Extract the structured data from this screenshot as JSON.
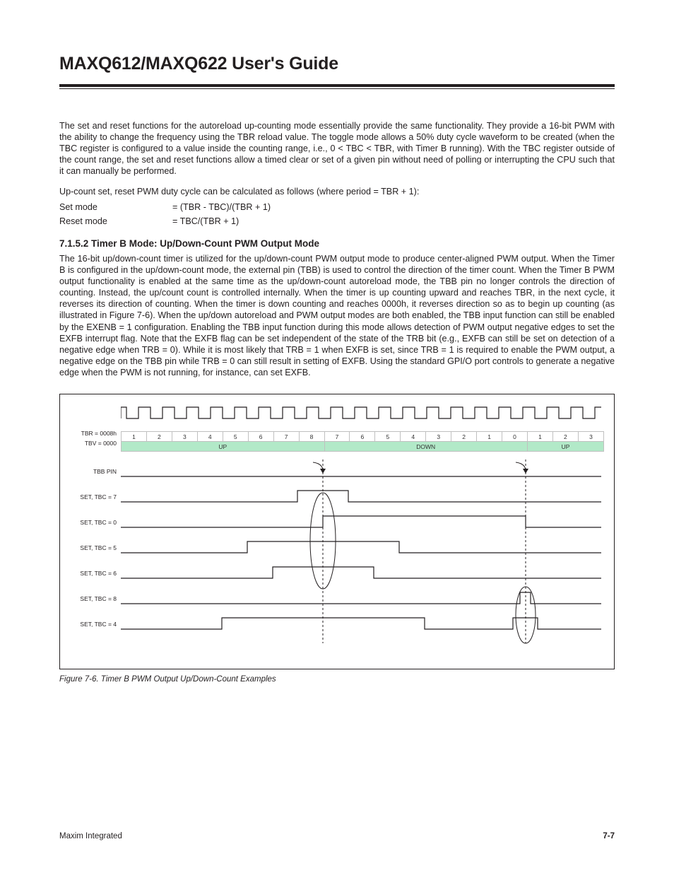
{
  "title": "MAXQ612/MAXQ622 User's Guide",
  "para1": "The set and reset functions for the autoreload up-counting mode essentially provide the same functionality. They provide a 16-bit PWM with the ability to change the frequency using the TBR reload value. The toggle mode allows a 50% duty cycle waveform to be created (when the TBC register is configured to a value inside the counting range, i.e., 0 < TBC < TBR, with Timer B running). With the TBC register outside of the count range, the set and reset functions allow a timed clear or set of a given pin without need of polling or interrupting the CPU such that it can manually be performed.",
  "para2": "Up-count set, reset PWM duty cycle can be calculated as follows (where period = TBR + 1):",
  "modes": {
    "set_label": "Set mode",
    "set_formula": "= (TBR - TBC)/(TBR + 1)",
    "reset_label": "Reset mode",
    "reset_formula": "= TBC/(TBR + 1)"
  },
  "section_heading": "7.1.5.2 Timer B Mode: Up/Down-Count PWM Output Mode",
  "para3": "The 16-bit up/down-count timer is utilized for the up/down-count PWM output mode to produce center-aligned PWM output. When the Timer B is configured in the up/down-count mode, the external pin (TBB) is used to control the direction of the timer count. When the Timer B PWM output functionality is enabled at the same time as the up/down-count autoreload mode, the TBB pin no longer controls the direction of counting. Instead, the up/count count is controlled internally. When the timer is up counting upward and reaches TBR, in the next cycle, it reverses its direction of counting. When the timer is down counting and reaches 0000h, it reverses direction so as to begin up counting (as illustrated in Figure 7-6). When the up/down autoreload and PWM output modes are both enabled, the TBB input function can still be enabled by the EXENB = 1 configuration. Enabling the TBB input function during this mode allows detection of PWM output negative edges to set the EXFB interrupt flag. Note that the EXFB flag can be set independent of the state of the TRB bit (e.g., EXFB can still be set on detection of a negative edge when TRB = 0). While it is most likely that TRB = 1 when EXFB is set, since TRB = 1 is required to enable the PWM output, a negative edge on the TBB pin while TRB = 0 can still result in setting of EXFB. Using the standard GPI/O port controls to generate a negative edge when the PWM is not running, for instance, can set EXFB.",
  "figure": {
    "tbr_label": "TBR = 0008h",
    "tbv_label": "TBV = 0000",
    "counts": [
      "1",
      "2",
      "3",
      "4",
      "5",
      "6",
      "7",
      "8",
      "7",
      "6",
      "5",
      "4",
      "3",
      "2",
      "1",
      "0",
      "1",
      "2",
      "3"
    ],
    "dir_labels": {
      "up": "UP",
      "down": "DOWN"
    },
    "rows": {
      "tbb": "TBB PIN",
      "r7": "SET, TBC = 7",
      "r0": "SET, TBC = 0",
      "r5": "SET, TBC = 5",
      "r6": "SET, TBC = 6",
      "r8": "SET, TBC = 8",
      "r4": "SET, TBC = 4"
    },
    "caption": "Figure 7-6. Timer B PWM Output Up/Down-Count Examples"
  },
  "footer": {
    "left": "Maxim Integrated",
    "right": "7-7"
  }
}
